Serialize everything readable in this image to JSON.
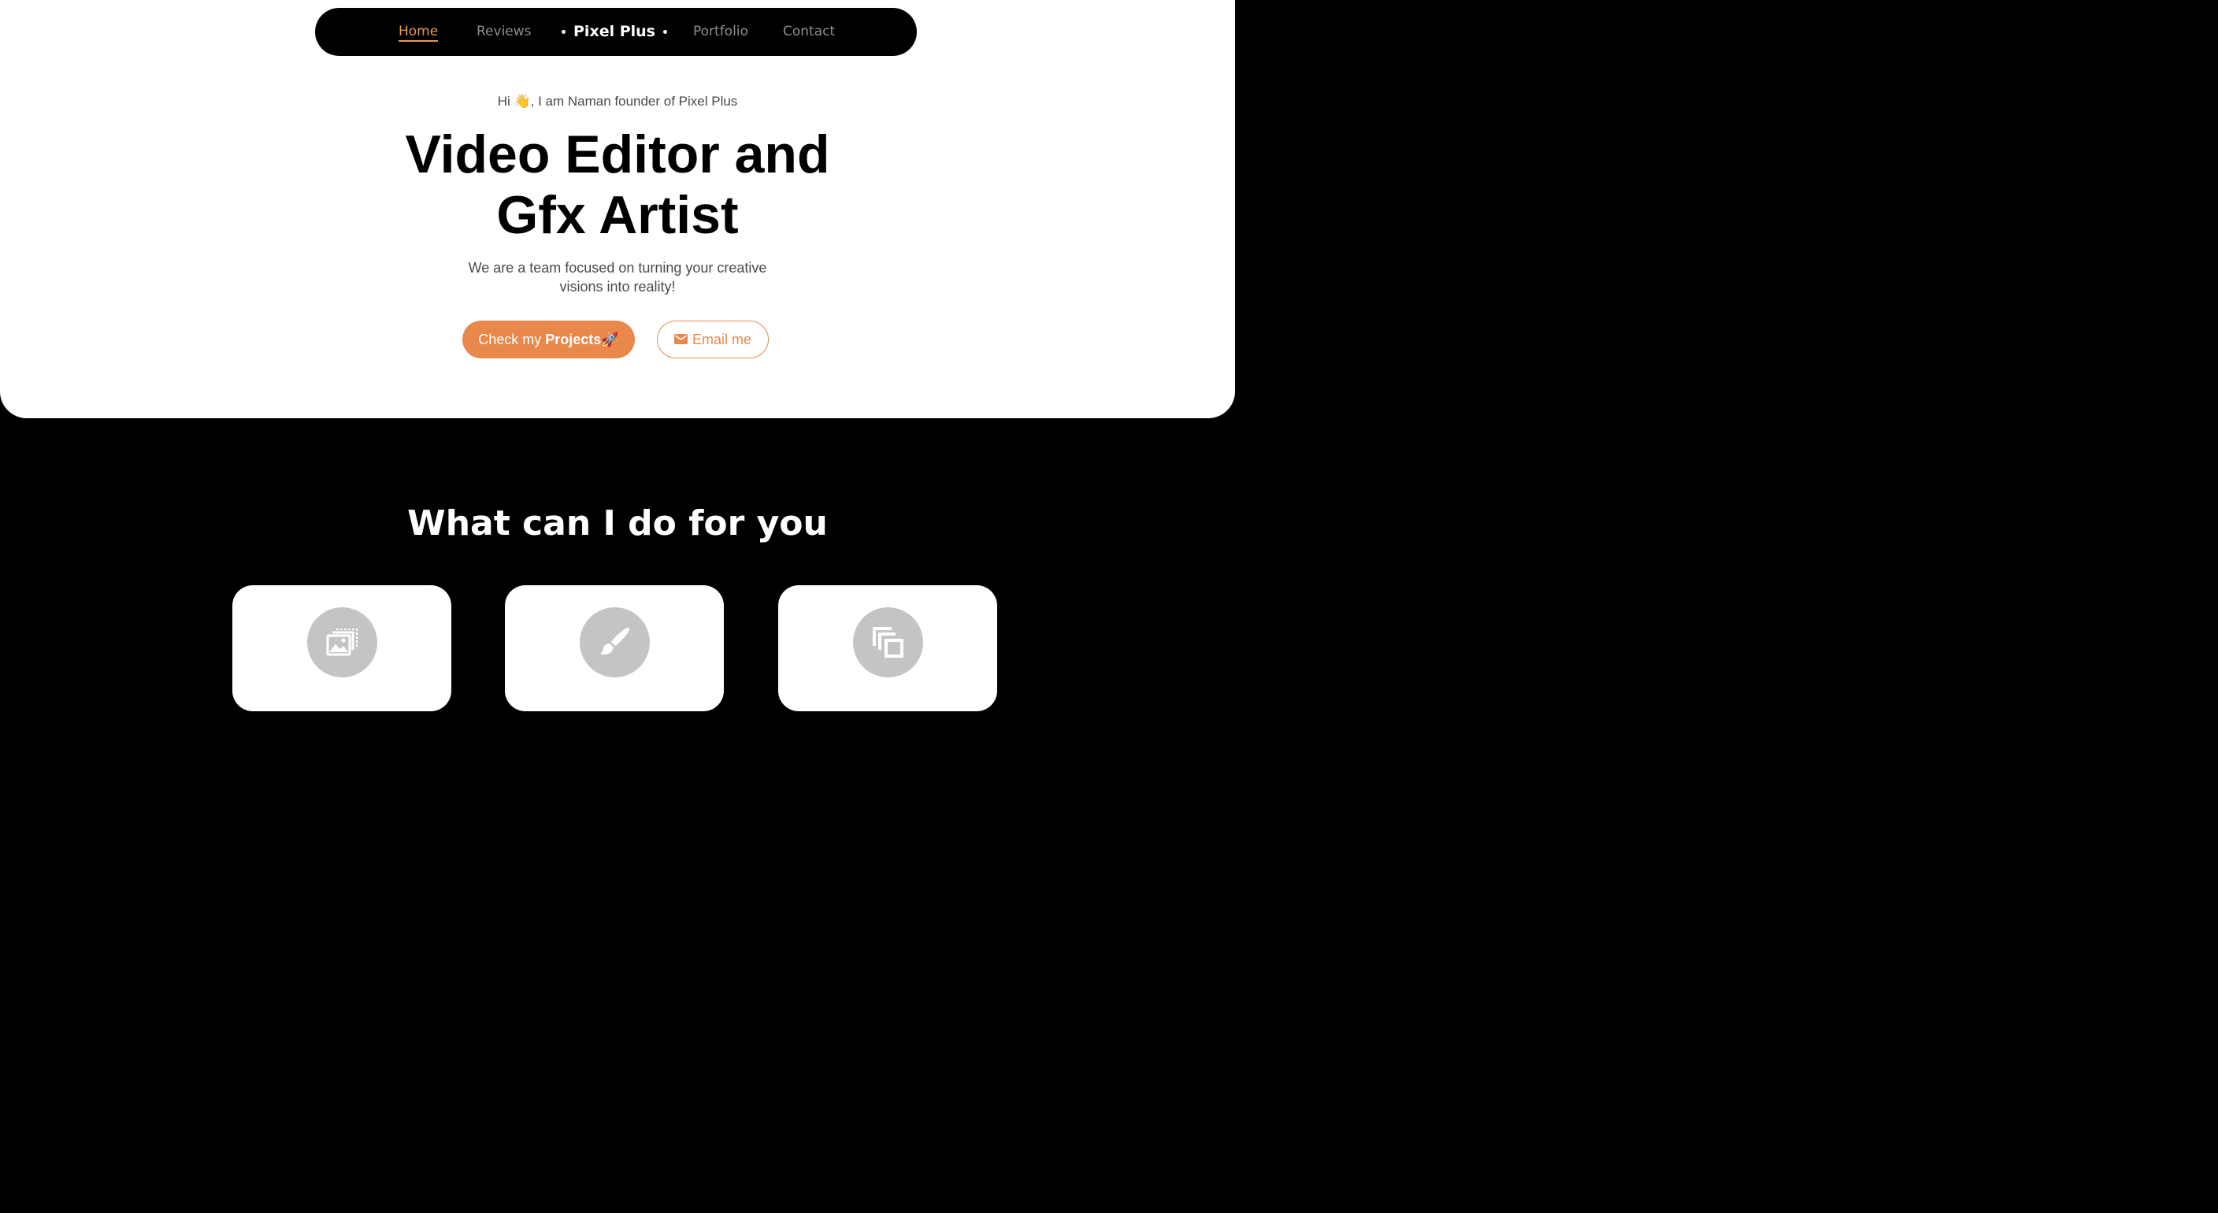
{
  "nav": {
    "home": "Home",
    "reviews": "Reviews",
    "brand": "Pixel Plus",
    "portfolio": "Portfolio",
    "contact": "Contact"
  },
  "hero": {
    "greeting": "Hi 👋, I am Naman founder of Pixel Plus",
    "headline_line1": "Video Editor and",
    "headline_line2": "Gfx Artist",
    "subtitle": "We are a team focused on turning your creative visions into reality!",
    "projects_button_prefix": "Check my ",
    "projects_button_bold": "Projects",
    "projects_button_emoji": "🚀",
    "email_button": "Email me"
  },
  "services": {
    "title": "What can I do for you",
    "cards": [
      {
        "icon": "image-gallery-icon"
      },
      {
        "icon": "paint-brush-icon"
      },
      {
        "icon": "copy-layers-icon"
      }
    ]
  },
  "colors": {
    "accent": "#e8884a",
    "nav_active": "#e8974a",
    "background_dark": "#000000",
    "icon_circle": "#c4c4c4"
  }
}
